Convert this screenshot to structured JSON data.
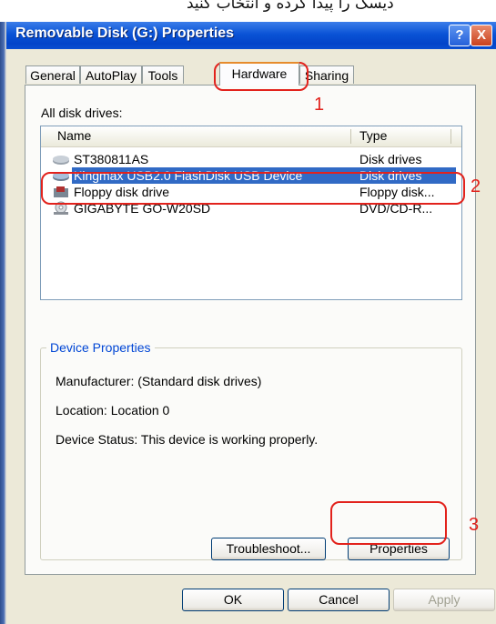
{
  "caption": "دیسک را پیدا کرده و انتخاب کنید",
  "window": {
    "title": "Removable Disk (G:) Properties",
    "help_label": "?",
    "close_label": "X"
  },
  "tabs": [
    "General",
    "AutoPlay",
    "Tools",
    "Hardware",
    "Sharing"
  ],
  "active_tab": "Hardware",
  "panel": {
    "all_drives_label": "All disk drives:",
    "columns": {
      "name": "Name",
      "type": "Type"
    },
    "rows": [
      {
        "name": "ST380811AS",
        "type": "Disk drives",
        "icon": "hard-disk-icon"
      },
      {
        "name": "Kingmax USB2.0 FlashDisk USB Device",
        "type": "Disk drives",
        "icon": "hard-disk-icon"
      },
      {
        "name": "Floppy disk drive",
        "type": "Floppy disk...",
        "icon": "floppy-drive-icon"
      },
      {
        "name": "GIGABYTE GO-W20SD",
        "type": "DVD/CD-R...",
        "icon": "cd-drive-icon"
      }
    ],
    "selected_row": "Kingmax USB2.0 FlashDisk USB Device",
    "device_properties": {
      "title": "Device Properties",
      "manufacturer": "Manufacturer: (Standard disk drives)",
      "location": "Location: Location 0",
      "status": "Device Status: This device is working properly."
    },
    "troubleshoot_label": "Troubleshoot...",
    "properties_label": "Properties"
  },
  "footer": {
    "ok_label": "OK",
    "cancel_label": "Cancel",
    "apply_label": "Apply"
  },
  "annotations": [
    "1",
    "2",
    "3"
  ],
  "colors": {
    "annotation": "#e2221c",
    "selection": "#316ac5",
    "titlebar": "#0a53d6",
    "active_tab_accent": "#e68b2c"
  }
}
